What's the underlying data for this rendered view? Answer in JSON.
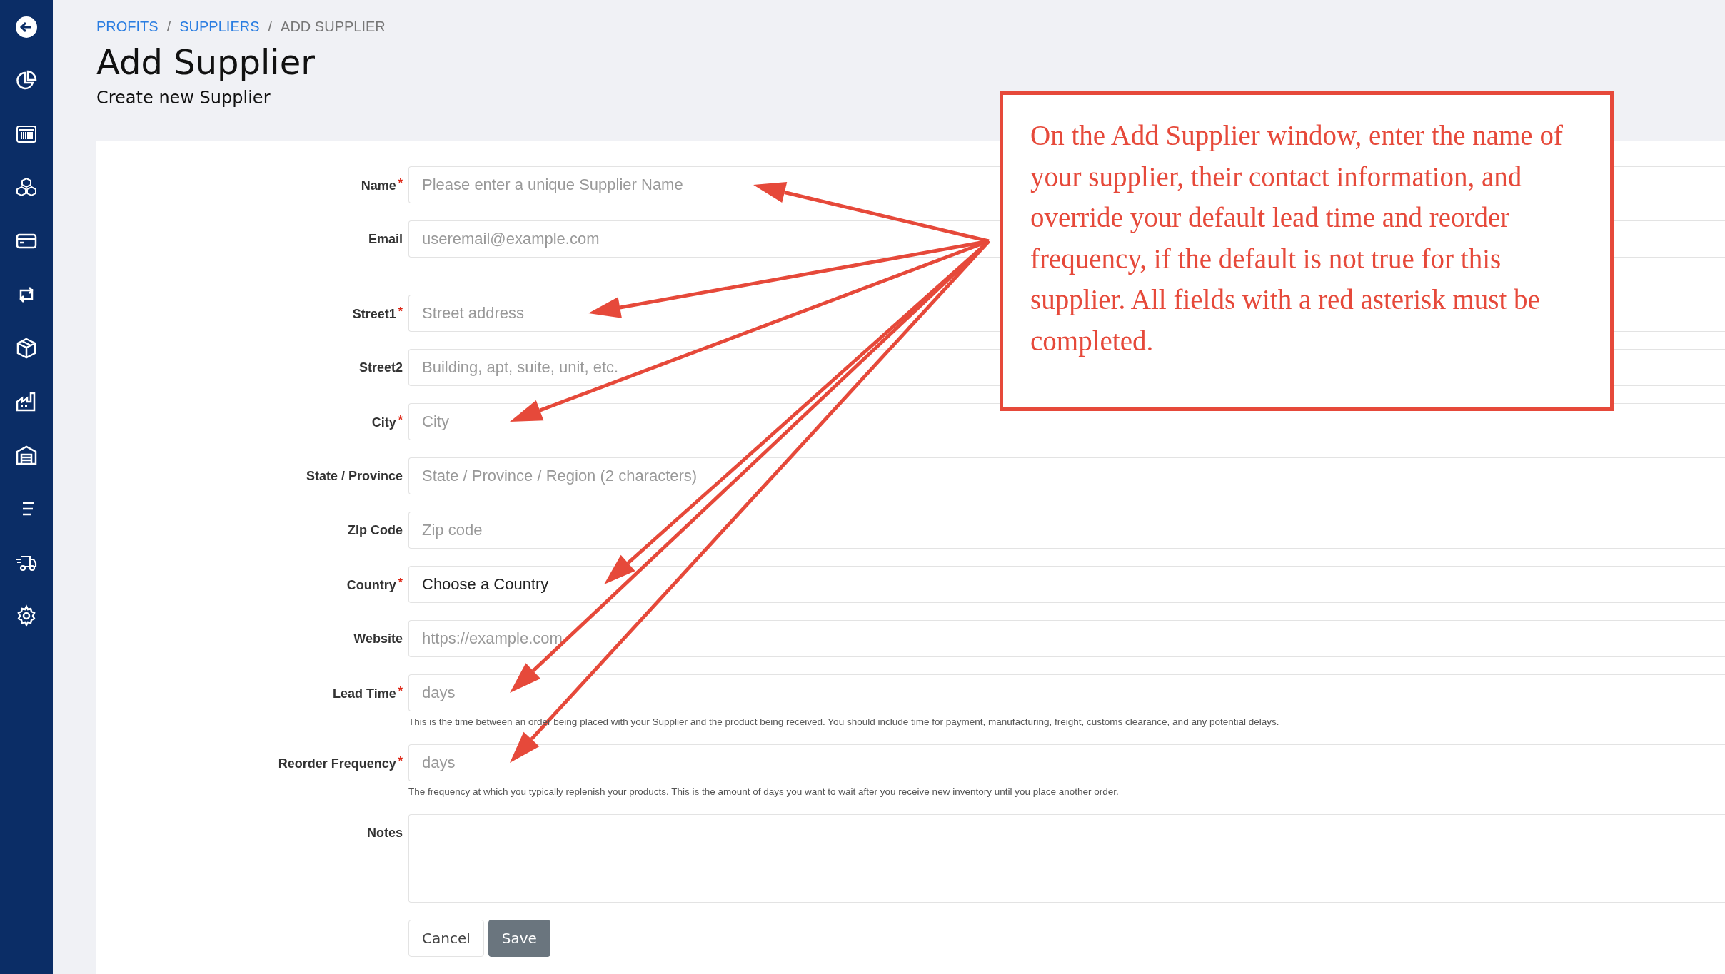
{
  "sidebar": {
    "items": [
      {
        "kind": "back"
      },
      {
        "kind": "pie"
      },
      {
        "kind": "barcode"
      },
      {
        "kind": "boxes"
      },
      {
        "kind": "card"
      },
      {
        "kind": "repeat"
      },
      {
        "kind": "box"
      },
      {
        "kind": "factory"
      },
      {
        "kind": "warehouse"
      },
      {
        "kind": "list"
      },
      {
        "kind": "truck"
      },
      {
        "kind": "gear"
      }
    ]
  },
  "breadcrumb": [
    {
      "label": "PROFITS",
      "link": true
    },
    {
      "label": "SUPPLIERS",
      "link": true
    },
    {
      "label": "ADD SUPPLIER",
      "link": false
    }
  ],
  "breadcrumb_separator": "/",
  "title": "Add Supplier",
  "subtitle": "Create new Supplier",
  "fields": [
    {
      "label": "Name",
      "required": true,
      "kind": "input",
      "placeholder": "Please enter a unique Supplier Name",
      "annotated": true
    },
    {
      "label": "Email",
      "required": false,
      "kind": "input",
      "placeholder": "useremail@example.com",
      "annotated": false
    },
    {
      "label": "Street1",
      "required": true,
      "kind": "input",
      "placeholder": "Street address",
      "annotated": true
    },
    {
      "label": "Street2",
      "required": false,
      "kind": "input",
      "placeholder": "Building, apt, suite, unit, etc.",
      "annotated": false
    },
    {
      "label": "City",
      "required": true,
      "kind": "input",
      "placeholder": "City",
      "annotated": true
    },
    {
      "label": "State / Province",
      "required": false,
      "kind": "input",
      "placeholder": "State / Province / Region (2 characters)",
      "annotated": false
    },
    {
      "label": "Zip Code",
      "required": false,
      "kind": "input",
      "placeholder": "Zip code",
      "annotated": false
    },
    {
      "label": "Country",
      "required": true,
      "kind": "select",
      "value": "Choose a Country",
      "annotated": true
    },
    {
      "label": "Website",
      "required": false,
      "kind": "input",
      "placeholder": "https://example.com",
      "annotated": false
    },
    {
      "label": "Lead Time",
      "required": true,
      "kind": "input",
      "placeholder": "days",
      "help": "This is the time between an order being placed with your Supplier and the product being received. You should include time for payment, manufacturing, freight, customs clearance, and any potential delays.",
      "annotated": true
    },
    {
      "label": "Reorder Frequency",
      "required": true,
      "kind": "input",
      "placeholder": "days",
      "help": "The frequency at which you typically replenish your products. This is the amount of days you want to wait after you receive new inventory until you place another order.",
      "annotated": true
    },
    {
      "label": "Notes",
      "required": false,
      "kind": "textarea",
      "annotated": false
    }
  ],
  "required_mark": "*",
  "buttons": [
    {
      "label": "Cancel",
      "primary": false
    },
    {
      "label": "Save",
      "primary": true
    }
  ],
  "callout": {
    "text": "On the Add Supplier window, enter the name of your supplier, their contact information, and override your default lead time and reorder frequency, if the default is not true for this supplier. All fields with a red asterisk must be completed."
  }
}
